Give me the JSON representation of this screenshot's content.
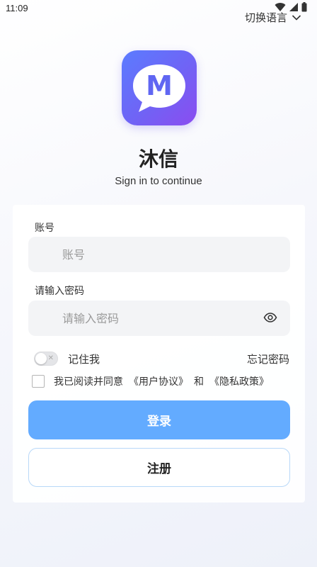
{
  "status_bar": {
    "time": "11:09",
    "icons": [
      "wifi-icon",
      "signal-icon",
      "battery-icon"
    ]
  },
  "header": {
    "language_switch": "切换语言",
    "language_icon": "chevron-down-icon"
  },
  "app": {
    "logo_letter": "M",
    "name": "沐信",
    "subtitle": "Sign in to continue"
  },
  "form": {
    "account": {
      "label": "账号",
      "placeholder": "账号",
      "value": ""
    },
    "password": {
      "label": "请输入密码",
      "placeholder": "请输入密码",
      "value": "",
      "toggle_icon": "eye-icon"
    },
    "remember_me": {
      "label": "记住我",
      "checked": false
    },
    "forgot_password": "忘记密码",
    "agreement": {
      "checked": false,
      "prefix": "我已阅读并同意",
      "user_agreement": "《用户协议》",
      "conjunction": "和",
      "privacy_policy": "《隐私政策》"
    },
    "login_button": "登录",
    "register_button": "注册"
  },
  "colors": {
    "primary": "#63abff",
    "logo_gradient_start": "#5b7cff",
    "logo_gradient_end": "#8b4cf0",
    "input_background": "#f3f4f6",
    "register_border": "#b8d8f8"
  }
}
